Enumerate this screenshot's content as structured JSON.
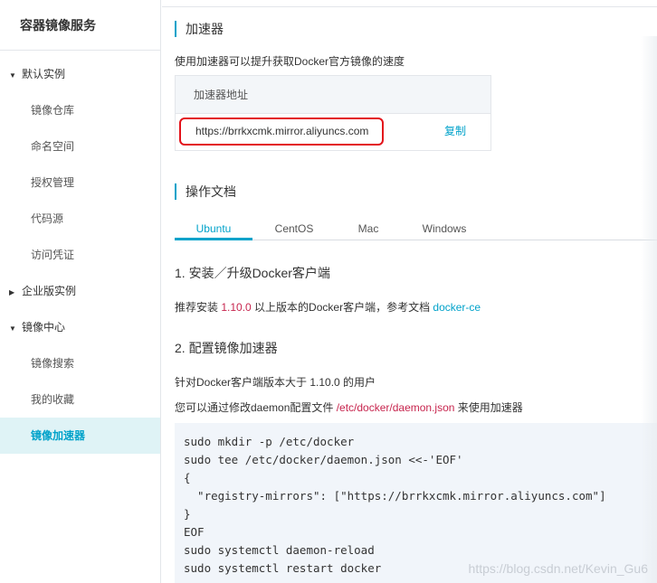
{
  "sidebar": {
    "title": "容器镜像服务",
    "groups": [
      {
        "label": "默认实例",
        "expanded": true,
        "items": [
          "镜像仓库",
          "命名空间",
          "授权管理",
          "代码源",
          "访问凭证"
        ]
      },
      {
        "label": "企业版实例",
        "expanded": false,
        "items": []
      },
      {
        "label": "镜像中心",
        "expanded": true,
        "items": [
          "镜像搜索",
          "我的收藏",
          "镜像加速器"
        ]
      }
    ],
    "active_item": "镜像加速器"
  },
  "accelerator": {
    "title": "加速器",
    "description": "使用加速器可以提升获取Docker官方镜像的速度",
    "table_header": "加速器地址",
    "url": "https://brrkxcmk.mirror.aliyuncs.com",
    "copy_label": "复制"
  },
  "docs": {
    "title": "操作文档",
    "tabs": [
      "Ubuntu",
      "CentOS",
      "Mac",
      "Windows"
    ],
    "active_tab": "Ubuntu",
    "step1": {
      "heading": "1. 安装／升级Docker客户端",
      "text_prefix": "推荐安装 ",
      "version": "1.10.0",
      "text_middle": " 以上版本的Docker客户端，参考文档 ",
      "link": "docker-ce"
    },
    "step2": {
      "heading": "2. 配置镜像加速器",
      "line1": "针对Docker客户端版本大于 1.10.0 的用户",
      "line2_prefix": "您可以通过修改daemon配置文件 ",
      "config_path": "/etc/docker/daemon.json",
      "line2_suffix": " 来使用加速器"
    },
    "code_lines": [
      "sudo mkdir -p /etc/docker",
      "sudo tee /etc/docker/daemon.json <<-'EOF'",
      "{",
      "  \"registry-mirrors\": [\"https://brrkxcmk.mirror.aliyuncs.com\"]",
      "}",
      "EOF",
      "sudo systemctl daemon-reload",
      "sudo systemctl restart docker"
    ]
  },
  "watermark": "https://blog.csdn.net/Kevin_Gu6",
  "colors": {
    "accent": "#00a2ca",
    "highlight_border": "#e3131b",
    "version_red": "#c7254e",
    "code_bg": "#f1f5fa",
    "active_item_bg": "#dff3f6"
  }
}
